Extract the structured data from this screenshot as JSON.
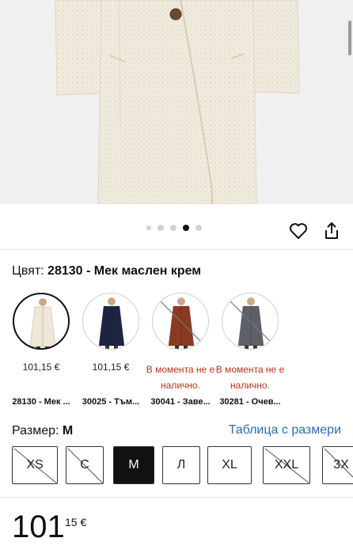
{
  "gallery": {
    "dots_total": 5,
    "active_index": 3
  },
  "actions": {
    "favorite_icon": "heart-icon",
    "share_icon": "share-icon"
  },
  "color": {
    "label": "Цвят:",
    "value": "28130 - Мек маслен крем"
  },
  "swatches": [
    {
      "price": "101,15 €",
      "unavailable": "",
      "code": "28130 - Мек ...",
      "selected": true,
      "available": true,
      "coat_color": "#efe7d7"
    },
    {
      "price": "101,15 €",
      "unavailable": "",
      "code": "30025 - Тъм...",
      "selected": false,
      "available": true,
      "coat_color": "#1f2540"
    },
    {
      "price": "",
      "unavailable": "В момента не е налично.",
      "code": "30041 - Заве...",
      "selected": false,
      "available": false,
      "coat_color": "#8a3a22"
    },
    {
      "price": "",
      "unavailable": "В момента не е налично.",
      "code": "30281 - Очев...",
      "selected": false,
      "available": false,
      "coat_color": "#5d6066"
    }
  ],
  "size": {
    "label": "Размер:",
    "value": "M",
    "table_link": "Таблица с размери",
    "options": [
      {
        "label": "XS",
        "available": false,
        "selected": false
      },
      {
        "label": "С",
        "available": false,
        "selected": false
      },
      {
        "label": "M",
        "available": true,
        "selected": true
      },
      {
        "label": "Л",
        "available": true,
        "selected": false
      },
      {
        "label": "XL",
        "available": true,
        "selected": false
      },
      {
        "label": "XXL",
        "available": false,
        "selected": false
      },
      {
        "label": "3X",
        "available": false,
        "selected": false
      }
    ]
  },
  "price": {
    "main": "101",
    "cents_currency": "15 €"
  },
  "colors": {
    "accent_link": "#2a6db0",
    "unavailable_text": "#b3341c",
    "selected_bg": "#111111"
  }
}
